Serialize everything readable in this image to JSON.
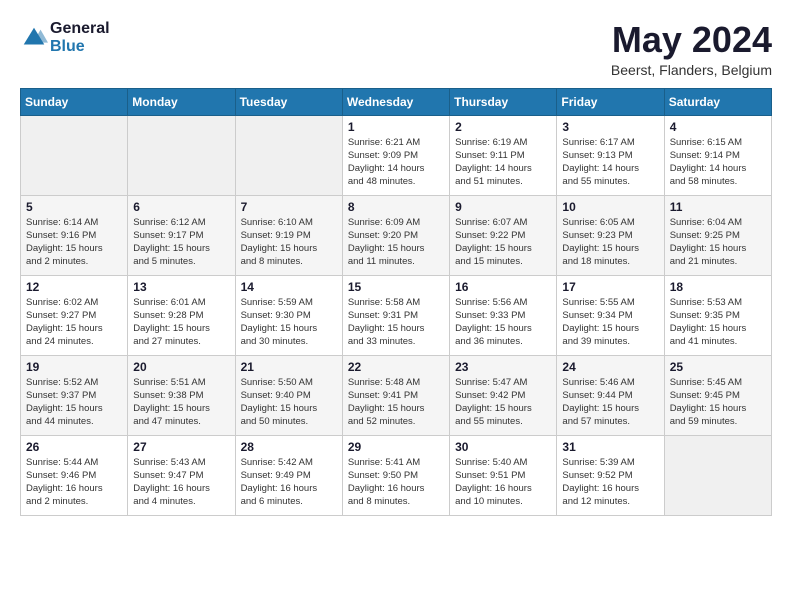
{
  "header": {
    "logo_general": "General",
    "logo_blue": "Blue",
    "month_year": "May 2024",
    "location": "Beerst, Flanders, Belgium"
  },
  "weekdays": [
    "Sunday",
    "Monday",
    "Tuesday",
    "Wednesday",
    "Thursday",
    "Friday",
    "Saturday"
  ],
  "weeks": [
    [
      {
        "day": "",
        "info": ""
      },
      {
        "day": "",
        "info": ""
      },
      {
        "day": "",
        "info": ""
      },
      {
        "day": "1",
        "info": "Sunrise: 6:21 AM\nSunset: 9:09 PM\nDaylight: 14 hours\nand 48 minutes."
      },
      {
        "day": "2",
        "info": "Sunrise: 6:19 AM\nSunset: 9:11 PM\nDaylight: 14 hours\nand 51 minutes."
      },
      {
        "day": "3",
        "info": "Sunrise: 6:17 AM\nSunset: 9:13 PM\nDaylight: 14 hours\nand 55 minutes."
      },
      {
        "day": "4",
        "info": "Sunrise: 6:15 AM\nSunset: 9:14 PM\nDaylight: 14 hours\nand 58 minutes."
      }
    ],
    [
      {
        "day": "5",
        "info": "Sunrise: 6:14 AM\nSunset: 9:16 PM\nDaylight: 15 hours\nand 2 minutes."
      },
      {
        "day": "6",
        "info": "Sunrise: 6:12 AM\nSunset: 9:17 PM\nDaylight: 15 hours\nand 5 minutes."
      },
      {
        "day": "7",
        "info": "Sunrise: 6:10 AM\nSunset: 9:19 PM\nDaylight: 15 hours\nand 8 minutes."
      },
      {
        "day": "8",
        "info": "Sunrise: 6:09 AM\nSunset: 9:20 PM\nDaylight: 15 hours\nand 11 minutes."
      },
      {
        "day": "9",
        "info": "Sunrise: 6:07 AM\nSunset: 9:22 PM\nDaylight: 15 hours\nand 15 minutes."
      },
      {
        "day": "10",
        "info": "Sunrise: 6:05 AM\nSunset: 9:23 PM\nDaylight: 15 hours\nand 18 minutes."
      },
      {
        "day": "11",
        "info": "Sunrise: 6:04 AM\nSunset: 9:25 PM\nDaylight: 15 hours\nand 21 minutes."
      }
    ],
    [
      {
        "day": "12",
        "info": "Sunrise: 6:02 AM\nSunset: 9:27 PM\nDaylight: 15 hours\nand 24 minutes."
      },
      {
        "day": "13",
        "info": "Sunrise: 6:01 AM\nSunset: 9:28 PM\nDaylight: 15 hours\nand 27 minutes."
      },
      {
        "day": "14",
        "info": "Sunrise: 5:59 AM\nSunset: 9:30 PM\nDaylight: 15 hours\nand 30 minutes."
      },
      {
        "day": "15",
        "info": "Sunrise: 5:58 AM\nSunset: 9:31 PM\nDaylight: 15 hours\nand 33 minutes."
      },
      {
        "day": "16",
        "info": "Sunrise: 5:56 AM\nSunset: 9:33 PM\nDaylight: 15 hours\nand 36 minutes."
      },
      {
        "day": "17",
        "info": "Sunrise: 5:55 AM\nSunset: 9:34 PM\nDaylight: 15 hours\nand 39 minutes."
      },
      {
        "day": "18",
        "info": "Sunrise: 5:53 AM\nSunset: 9:35 PM\nDaylight: 15 hours\nand 41 minutes."
      }
    ],
    [
      {
        "day": "19",
        "info": "Sunrise: 5:52 AM\nSunset: 9:37 PM\nDaylight: 15 hours\nand 44 minutes."
      },
      {
        "day": "20",
        "info": "Sunrise: 5:51 AM\nSunset: 9:38 PM\nDaylight: 15 hours\nand 47 minutes."
      },
      {
        "day": "21",
        "info": "Sunrise: 5:50 AM\nSunset: 9:40 PM\nDaylight: 15 hours\nand 50 minutes."
      },
      {
        "day": "22",
        "info": "Sunrise: 5:48 AM\nSunset: 9:41 PM\nDaylight: 15 hours\nand 52 minutes."
      },
      {
        "day": "23",
        "info": "Sunrise: 5:47 AM\nSunset: 9:42 PM\nDaylight: 15 hours\nand 55 minutes."
      },
      {
        "day": "24",
        "info": "Sunrise: 5:46 AM\nSunset: 9:44 PM\nDaylight: 15 hours\nand 57 minutes."
      },
      {
        "day": "25",
        "info": "Sunrise: 5:45 AM\nSunset: 9:45 PM\nDaylight: 15 hours\nand 59 minutes."
      }
    ],
    [
      {
        "day": "26",
        "info": "Sunrise: 5:44 AM\nSunset: 9:46 PM\nDaylight: 16 hours\nand 2 minutes."
      },
      {
        "day": "27",
        "info": "Sunrise: 5:43 AM\nSunset: 9:47 PM\nDaylight: 16 hours\nand 4 minutes."
      },
      {
        "day": "28",
        "info": "Sunrise: 5:42 AM\nSunset: 9:49 PM\nDaylight: 16 hours\nand 6 minutes."
      },
      {
        "day": "29",
        "info": "Sunrise: 5:41 AM\nSunset: 9:50 PM\nDaylight: 16 hours\nand 8 minutes."
      },
      {
        "day": "30",
        "info": "Sunrise: 5:40 AM\nSunset: 9:51 PM\nDaylight: 16 hours\nand 10 minutes."
      },
      {
        "day": "31",
        "info": "Sunrise: 5:39 AM\nSunset: 9:52 PM\nDaylight: 16 hours\nand 12 minutes."
      },
      {
        "day": "",
        "info": ""
      }
    ]
  ]
}
